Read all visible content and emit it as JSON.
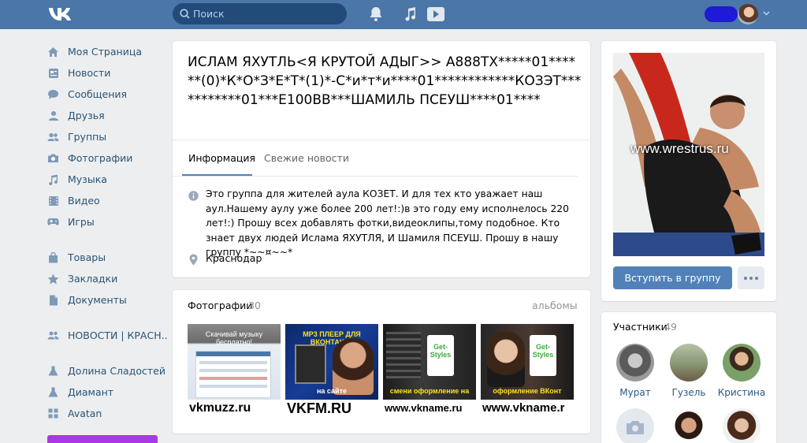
{
  "header": {
    "search_placeholder": "Поиск",
    "icons": [
      "vk-logo-icon",
      "search-icon",
      "bell-icon",
      "music-note-icon",
      "video-play-icon",
      "chevron-down-icon"
    ]
  },
  "menu": {
    "items": [
      {
        "label": "Моя Страница",
        "icon": "home-icon"
      },
      {
        "label": "Новости",
        "icon": "news-icon"
      },
      {
        "label": "Сообщения",
        "icon": "messages-icon"
      },
      {
        "label": "Друзья",
        "icon": "friends-icon"
      },
      {
        "label": "Группы",
        "icon": "groups-icon"
      },
      {
        "label": "Фотографии",
        "icon": "camera-icon"
      },
      {
        "label": "Музыка",
        "icon": "music-icon"
      },
      {
        "label": "Видео",
        "icon": "video-icon"
      },
      {
        "label": "Игры",
        "icon": "gamepad-icon"
      }
    ],
    "items2": [
      {
        "label": "Товары",
        "icon": "bag-icon"
      },
      {
        "label": "Закладки",
        "icon": "star-icon"
      },
      {
        "label": "Документы",
        "icon": "document-icon"
      }
    ],
    "items3": [
      {
        "label": "НОВОСТИ | КРАСН..",
        "icon": "community-icon"
      }
    ],
    "items4": [
      {
        "label": "Долина Сладостей",
        "icon": "flask-icon"
      },
      {
        "label": "Диамант",
        "icon": "flask-icon"
      },
      {
        "label": "Avatan",
        "icon": "grid-icon"
      }
    ]
  },
  "group": {
    "title": "ИСЛАМ ЯХУТЛЬ<Я КРУТОЙ АДЫГ>> А888ТХ*****01******(0)*К*О*З*Е*Т*(1)*-С*и*т*и****01************КОЗЭТ***********01***Е100ВВ***ШАМИЛЬ ПСЕУШ****01****",
    "tabs": [
      "Информация",
      "Свежие новости"
    ],
    "description": "Это группа для жителей аула КОЗЕТ. И для тех кто уважает наш аул.Нашему аулу уже более 200 лет!:)в это году ему исполнелось 220 лет!:) Прошу всех добавлять фотки,видеоклипы,тому подобное. Кто знает двух людей Ислама ЯХУТЛЯ, И Шамиля ПСЕУШ. Прошу в нашу группу *~~¤~~*",
    "location": "Краснодар"
  },
  "photos": {
    "title": "Фотографии",
    "count": "30",
    "albums_link": "альбомы",
    "items": [
      {
        "top": "Скачивай музыку бесплатно!",
        "caption": "vkmuzz.ru"
      },
      {
        "top": "MP3 ПЛЕЕР ДЛЯ ВКОНТАКТЕ",
        "mid": "на сайте",
        "caption": "VKFM.RU"
      },
      {
        "top": "Get-Styles",
        "mid": "смени оформление на",
        "caption": "www.vkname.ru"
      },
      {
        "top": "Get-Styles",
        "mid": "оформление ВКонт",
        "caption": "www.vkname.r"
      }
    ]
  },
  "cover": {
    "watermark": "www.wrestrus.ru"
  },
  "actions": {
    "join_label": "Вступить в группу"
  },
  "members": {
    "title": "Участники",
    "count": "49",
    "people": [
      {
        "name": "Мурат"
      },
      {
        "name": "Гузель"
      },
      {
        "name": "Кристина"
      }
    ]
  },
  "colors": {
    "header_bg": "#4a76a8",
    "accent": "#5181b8",
    "link": "#2a5885",
    "page_bg": "#edeef0"
  }
}
